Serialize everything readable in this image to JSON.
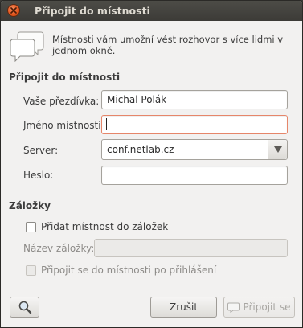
{
  "window": {
    "title": "Připojit do místnosti"
  },
  "info": {
    "text": "Místnosti vám umožní vést rozhovor s více lidmi v jednom okně.",
    "icon": "chat-bubbles-icon"
  },
  "join_section": {
    "title": "Připojit do místnosti",
    "nickname_label": "Vaše přezdívka:",
    "nickname_value": "Michal Polák",
    "room_label": "Jméno místnosti:",
    "room_value": "",
    "server_label": "Server:",
    "server_value": "conf.netlab.cz",
    "password_label": "Heslo:",
    "password_value": ""
  },
  "bookmarks": {
    "title": "Záložky",
    "add_bookmark_label": "Přidat místnost do záložek",
    "add_bookmark_checked": false,
    "bookmark_name_label": "Název záložky:",
    "bookmark_name_value": "",
    "autojoin_label": "Připojit se do místnosti po přihlášení",
    "autojoin_checked": false
  },
  "buttons": {
    "browse_icon": "magnifier-icon",
    "cancel_label": "Zrušit",
    "join_label": "Připojit se"
  },
  "colors": {
    "titlebar": "#3c3b37",
    "close_button": "#e3551d",
    "focus_border": "#e6866a",
    "window_bg": "#f2f1f0"
  }
}
